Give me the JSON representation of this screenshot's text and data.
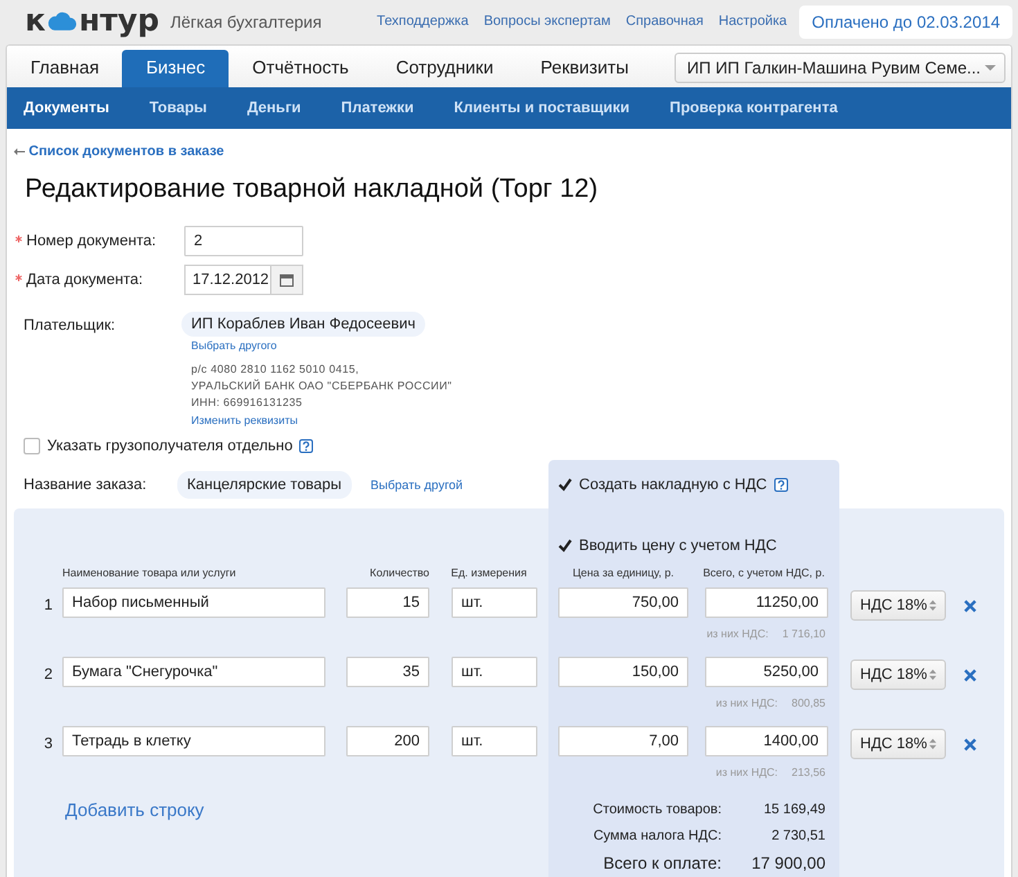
{
  "header": {
    "logo": {
      "before": "к",
      "after": "нтур"
    },
    "product": "Лёгкая бухгалтерия",
    "links": [
      "Техподдержка",
      "Вопросы экспертам",
      "Справочная",
      "Настройка"
    ],
    "paid_until": "Оплачено до 02.03.2014"
  },
  "tabs": [
    {
      "label": "Главная",
      "selected": false
    },
    {
      "label": "Бизнес",
      "selected": true
    },
    {
      "label": "Отчётность",
      "selected": false
    },
    {
      "label": "Сотрудники",
      "selected": false
    },
    {
      "label": "Реквизиты",
      "selected": false
    }
  ],
  "company_selector": {
    "value": "ИП ИП Галкин-Машина Рувим Семе..."
  },
  "subnav": [
    {
      "label": "Документы",
      "selected": true
    },
    {
      "label": "Товары",
      "selected": false
    },
    {
      "label": "Деньги",
      "selected": false
    },
    {
      "label": "Платежки",
      "selected": false
    },
    {
      "label": "Клиенты и поставщики",
      "selected": false
    },
    {
      "label": "Проверка контрагента",
      "selected": false
    }
  ],
  "back_link": "Список документов в заказе",
  "title": "Редактирование товарной накладной (Торг 12)",
  "fields": [
    {
      "label": "Номер документа:",
      "required": true,
      "value": "2",
      "kind": "text"
    },
    {
      "label": "Дата документа:",
      "required": true,
      "value": "17.12.2012",
      "kind": "date"
    }
  ],
  "payer": {
    "label": "Плательщик:",
    "name": "ИП Кораблев Иван Федосеевич",
    "choose_link": "Выбрать другого",
    "details": [
      "р/с 4080 2810 1162 5010 0415,",
      "УРАЛЬСКИЙ БАНК ОАО \"СБЕРБАНК РОССИИ\"",
      "ИНН: 669916131235"
    ],
    "edit_link": "Изменить реквизиты"
  },
  "consignee_checkbox": {
    "label": "Указать грузополучателя отдельно",
    "checked": false
  },
  "order": {
    "label": "Название заказа:",
    "name": "Канцелярские товары",
    "choose_link": "Выбрать другой"
  },
  "vat_invoice_checkbox": {
    "label": "Создать накладную с НДС",
    "checked": true
  },
  "price_with_vat_checkbox": {
    "label": "Вводить цену с учетом НДС",
    "checked": true
  },
  "table": {
    "columns": [
      "Наименование товара или услуги",
      "Количество",
      "Ед. измерения",
      "Цена за единицу, р.",
      "Всего, с учетом НДС, р."
    ],
    "rows": [
      {
        "number": "1",
        "name": "Набор письменный",
        "quantity": "15",
        "unit": "шт.",
        "price": "750,00",
        "total": "11250,00",
        "vat_label": "из них НДС:",
        "vat_amount": "1 716,10",
        "vat_rate": "НДС 18%"
      },
      {
        "number": "2",
        "name": "Бумага \"Снегурочка\"",
        "quantity": "35",
        "unit": "шт.",
        "price": "150,00",
        "total": "5250,00",
        "vat_label": "из них НДС:",
        "vat_amount": "800,85",
        "vat_rate": "НДС 18%"
      },
      {
        "number": "3",
        "name": "Тетрадь в клетку",
        "quantity": "200",
        "unit": "шт.",
        "price": "7,00",
        "total": "1400,00",
        "vat_label": "из них НДС:",
        "vat_amount": "213,56",
        "vat_rate": "НДС 18%"
      }
    ],
    "add_row_link": "Добавить строку",
    "totals": [
      {
        "label": "Стоимость товаров:",
        "value": "15 169,49"
      },
      {
        "label": "Сумма налога НДС:",
        "value": "2 730,51"
      },
      {
        "label": "Всего к оплате:",
        "value": "17 900,00",
        "kind": "grand"
      }
    ]
  }
}
